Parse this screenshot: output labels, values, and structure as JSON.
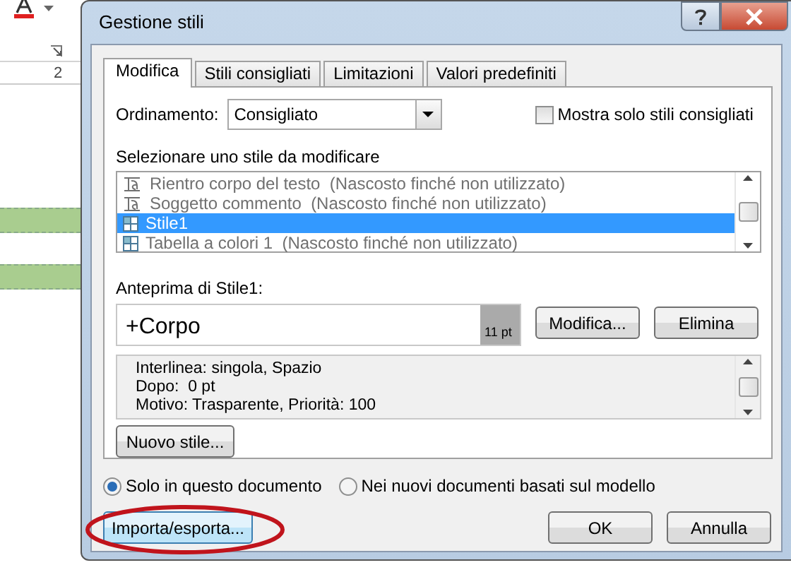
{
  "document": {
    "ruler_label": "2"
  },
  "window": {
    "title": "Gestione stili"
  },
  "tabs": [
    {
      "label": "Modifica",
      "selected": true
    },
    {
      "label": "Stili consigliati",
      "selected": false
    },
    {
      "label": "Limitazioni",
      "selected": false
    },
    {
      "label": "Valori predefiniti",
      "selected": false
    }
  ],
  "sort": {
    "label": "Ordinamento:",
    "value": "Consigliato"
  },
  "show_recommended": {
    "label": "Mostra solo stili consigliati",
    "checked": false
  },
  "style_list": {
    "label": "Selezionare uno stile da modificare",
    "items": [
      {
        "kind": "paragraph",
        "text": "Rientro corpo del testo",
        "note": "(Nascosto finché non utilizzato)",
        "hidden": true,
        "selected": false
      },
      {
        "kind": "paragraph",
        "text": "Soggetto commento",
        "note": "(Nascosto finché non utilizzato)",
        "hidden": true,
        "selected": false
      },
      {
        "kind": "table",
        "text": "Stile1",
        "hidden": false,
        "selected": true
      },
      {
        "kind": "table",
        "text": "Tabella a colori 1",
        "note": "(Nascosto finché non utilizzato)",
        "hidden": true,
        "selected": false
      }
    ]
  },
  "preview": {
    "label": "Anteprima di Stile1:",
    "text": "+Corpo",
    "size": "11 pt"
  },
  "style_buttons": [
    "Modifica...",
    "Elimina"
  ],
  "description": [
    "Interlinea: singola, Spazio",
    "Dopo:  0 pt",
    "Motivo: Trasparente, Priorità: 100"
  ],
  "new_style_button": "Nuovo stile...",
  "scope": [
    {
      "label": "Solo in questo documento",
      "selected": true
    },
    {
      "label": "Nei nuovi documenti basati sul modello",
      "selected": false
    }
  ],
  "import_button": {
    "label": "Importa/esporta...",
    "circled": true
  },
  "buttons": [
    "OK",
    "Annulla"
  ]
}
